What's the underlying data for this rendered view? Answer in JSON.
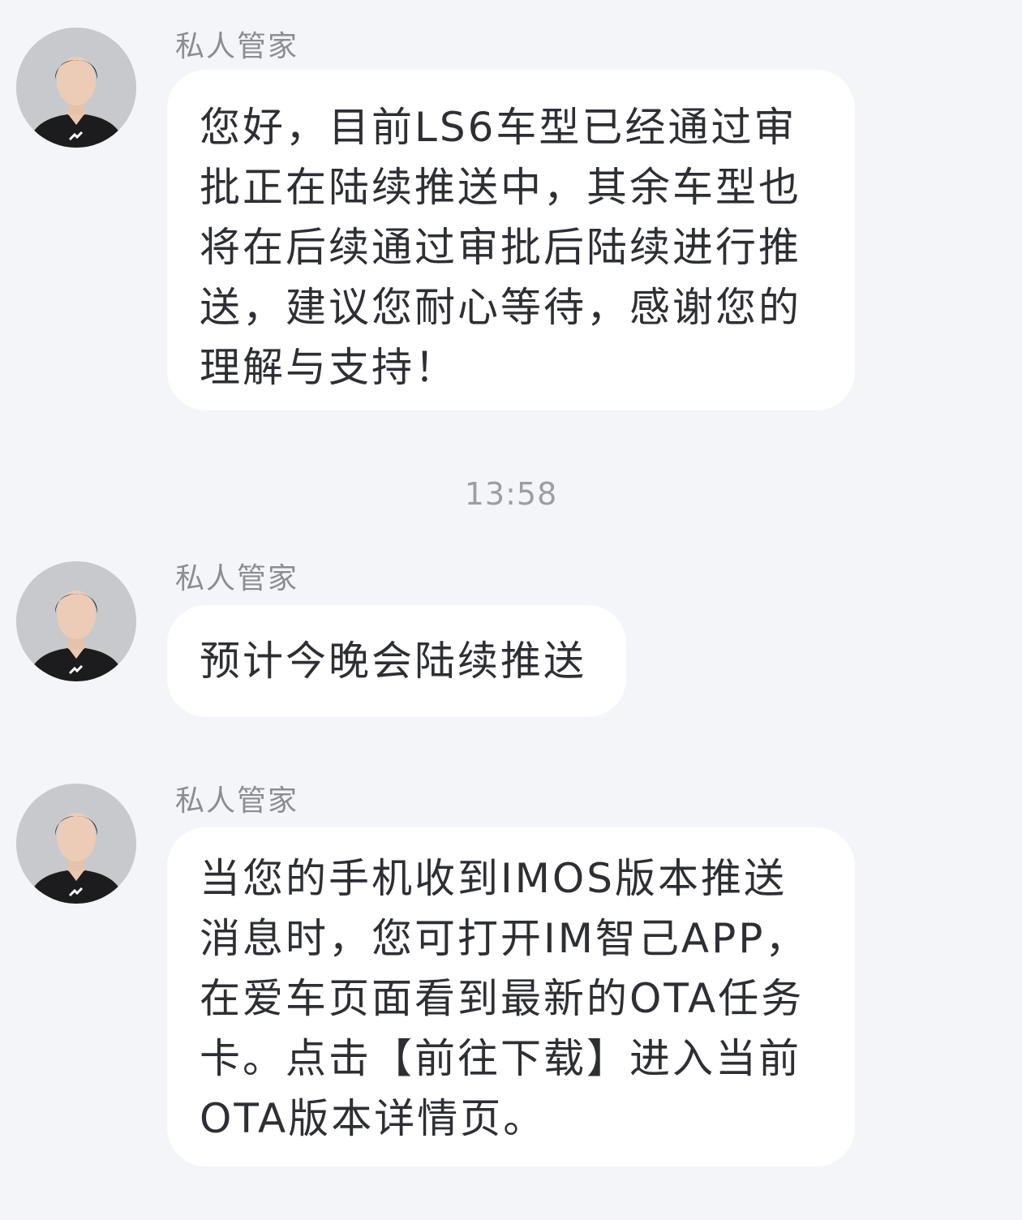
{
  "chat": {
    "timestamp": "13:58",
    "messages": [
      {
        "sender": "私人管家",
        "avatar_icon": "agent-avatar-icon",
        "text": "您好，目前LS6车型已经通过审批正在陆续推送中，其余车型也将在后续通过审批后陆续进行推送，建议您耐心等待，感谢您的理解与支持！"
      },
      {
        "sender": "私人管家",
        "avatar_icon": "agent-avatar-icon",
        "text": "预计今晚会陆续推送"
      },
      {
        "sender": "私人管家",
        "avatar_icon": "agent-avatar-icon",
        "text": "当您的手机收到IMOS版本推送消息时，您可打开IM智己APP，在爱车页面看到最新的OTA任务卡。点击【前往下载】进入当前OTA版本详情页。"
      }
    ]
  },
  "colors": {
    "background": "#f4f5f9",
    "bubble": "#ffffff",
    "text": "#2d2f33",
    "sender": "#8b8d93",
    "timestamp": "#9c9ea3"
  }
}
